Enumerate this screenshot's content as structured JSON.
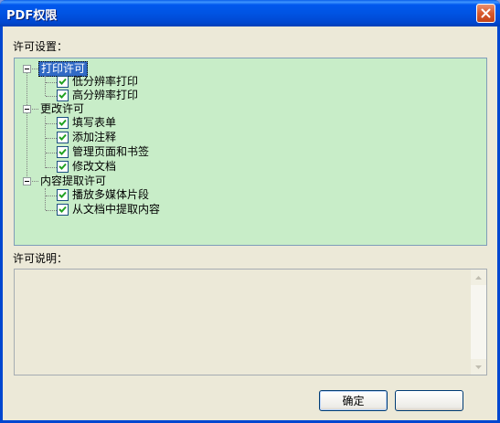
{
  "window": {
    "title": "PDF权限"
  },
  "settings": {
    "label": "许可设置："
  },
  "tree": {
    "groups": [
      {
        "label": "打印许可",
        "selected": true,
        "children": [
          {
            "label": "低分辨率打印",
            "checked": true
          },
          {
            "label": "高分辨率打印",
            "checked": true
          }
        ]
      },
      {
        "label": "更改许可",
        "selected": false,
        "children": [
          {
            "label": "填写表单",
            "checked": true
          },
          {
            "label": "添加注释",
            "checked": true
          },
          {
            "label": "管理页面和书签",
            "checked": true
          },
          {
            "label": "修改文档",
            "checked": true
          }
        ]
      },
      {
        "label": "内容提取许可",
        "selected": false,
        "children": [
          {
            "label": "播放多媒体片段",
            "checked": true
          },
          {
            "label": "从文档中提取内容",
            "checked": true
          }
        ]
      }
    ]
  },
  "description": {
    "label": "许可说明：",
    "text": ""
  },
  "buttons": {
    "ok_label": "确定"
  },
  "colors": {
    "tree_background": "#c8edc8",
    "selection": "#316ac5",
    "titlebar": "#0054e3",
    "dialog_face": "#ece9d8"
  },
  "icons": {
    "close": "close-icon",
    "expander": "minus-box-icon",
    "check": "checkmark-icon",
    "scroll_up": "arrow-up-icon",
    "scroll_down": "arrow-down-icon"
  }
}
